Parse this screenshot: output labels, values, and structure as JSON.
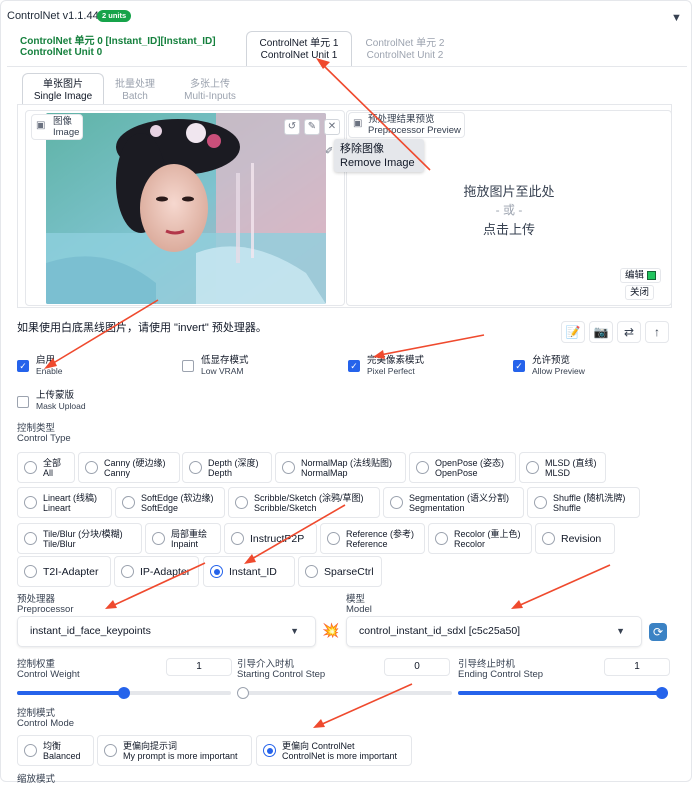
{
  "header": {
    "title": "ControlNet v1.1.441",
    "units_badge": "2 units",
    "collapse_icon": "triangle-down-icon"
  },
  "unit_tabs": [
    {
      "label_zh": "ControlNet 单元 0 [Instant_ID][Instant_ID]",
      "label_en": "ControlNet Unit 0"
    },
    {
      "label_zh": "ControlNet 单元 1",
      "label_en": "ControlNet Unit 1"
    },
    {
      "label_zh": "ControlNet 单元 2",
      "label_en": "ControlNet Unit 2"
    }
  ],
  "input_tabs": [
    {
      "label_zh": "单张图片",
      "label_en": "Single Image"
    },
    {
      "label_zh": "批量处理",
      "label_en": "Batch"
    },
    {
      "label_zh": "多张上传",
      "label_en": "Multi-Inputs"
    }
  ],
  "image_panel": {
    "label_zh": "图像",
    "label_en": "Image"
  },
  "preview_panel": {
    "label_zh": "预处理结果预览",
    "label_en": "Preprocessor Preview"
  },
  "tooltip": {
    "zh": "移除图像",
    "en": "Remove Image"
  },
  "drop": {
    "line1": "拖放图片至此处",
    "line2": "- 或 -",
    "line3": "点击上传"
  },
  "edit_button": "编辑",
  "close_button": "关闭",
  "hint": "如果使用白底黑线图片，请使用 \"invert\" 预处理器。",
  "checkboxes": [
    {
      "zh": "启用",
      "en": "Enable",
      "checked": true
    },
    {
      "zh": "低显存模式",
      "en": "Low VRAM",
      "checked": false
    },
    {
      "zh": "完美像素模式",
      "en": "Pixel Perfect",
      "checked": true
    },
    {
      "zh": "允许预览",
      "en": "Allow Preview",
      "checked": true
    },
    {
      "zh": "上传蒙版",
      "en": "Mask Upload",
      "checked": false
    }
  ],
  "control_type": {
    "label_zh": "控制类型",
    "label_en": "Control Type",
    "options": [
      {
        "zh": "全部",
        "en": "All"
      },
      {
        "zh": "Canny (硬边缘)",
        "en": "Canny"
      },
      {
        "zh": "Depth (深度)",
        "en": "Depth"
      },
      {
        "zh": "NormalMap (法线贴图)",
        "en": "NormalMap"
      },
      {
        "zh": "OpenPose (姿态)",
        "en": "OpenPose"
      },
      {
        "zh": "MLSD (直线)",
        "en": "MLSD"
      },
      {
        "zh": "Lineart (线稿)",
        "en": "Lineart"
      },
      {
        "zh": "SoftEdge (软边缘)",
        "en": "SoftEdge"
      },
      {
        "zh": "Scribble/Sketch (涂鸦/草图)",
        "en": "Scribble/Sketch"
      },
      {
        "zh": "Segmentation (语义分割)",
        "en": "Segmentation"
      },
      {
        "zh": "Shuffle (随机洗牌)",
        "en": "Shuffle"
      },
      {
        "zh": "Tile/Blur (分块/模糊)",
        "en": "Tile/Blur"
      },
      {
        "zh": "局部重绘",
        "en": "Inpaint"
      },
      {
        "zh": "InstructP2P",
        "en": ""
      },
      {
        "zh": "Reference (参考)",
        "en": "Reference"
      },
      {
        "zh": "Recolor (重上色)",
        "en": "Recolor"
      },
      {
        "zh": "Revision",
        "en": ""
      },
      {
        "zh": "T2I-Adapter",
        "en": ""
      },
      {
        "zh": "IP-Adapter",
        "en": ""
      },
      {
        "zh": "Instant_ID",
        "en": ""
      },
      {
        "zh": "SparseCtrl",
        "en": ""
      }
    ],
    "selected": "Instant_ID"
  },
  "preprocessor": {
    "label_zh": "预处理器",
    "label_en": "Preprocessor",
    "value": "instant_id_face_keypoints",
    "run_icon": "explosion-icon"
  },
  "model": {
    "label_zh": "模型",
    "label_en": "Model",
    "value": "control_instant_id_sdxl [c5c25a50]",
    "refresh_icon": "refresh-icon"
  },
  "sliders": [
    {
      "zh": "控制权重",
      "en": "Control Weight",
      "value": "1",
      "fraction": 0.5
    },
    {
      "zh": "引导介入时机",
      "en": "Starting Control Step",
      "value": "0",
      "fraction": 0.0
    },
    {
      "zh": "引导终止时机",
      "en": "Ending Control Step",
      "value": "1",
      "fraction": 1.0
    }
  ],
  "control_mode": {
    "label_zh": "控制模式",
    "label_en": "Control Mode",
    "options": [
      {
        "zh": "均衡",
        "en": "Balanced"
      },
      {
        "zh": "更偏向提示词",
        "en": "My prompt is more important"
      },
      {
        "zh": "更偏向 ControlNet",
        "en": "ControlNet is more important"
      }
    ],
    "selected": "更偏向 ControlNet"
  },
  "next_section_label": "缩放模式",
  "colors": {
    "accent": "#2563eb",
    "green": "#15803d",
    "annotation": "#ef4a2e"
  }
}
